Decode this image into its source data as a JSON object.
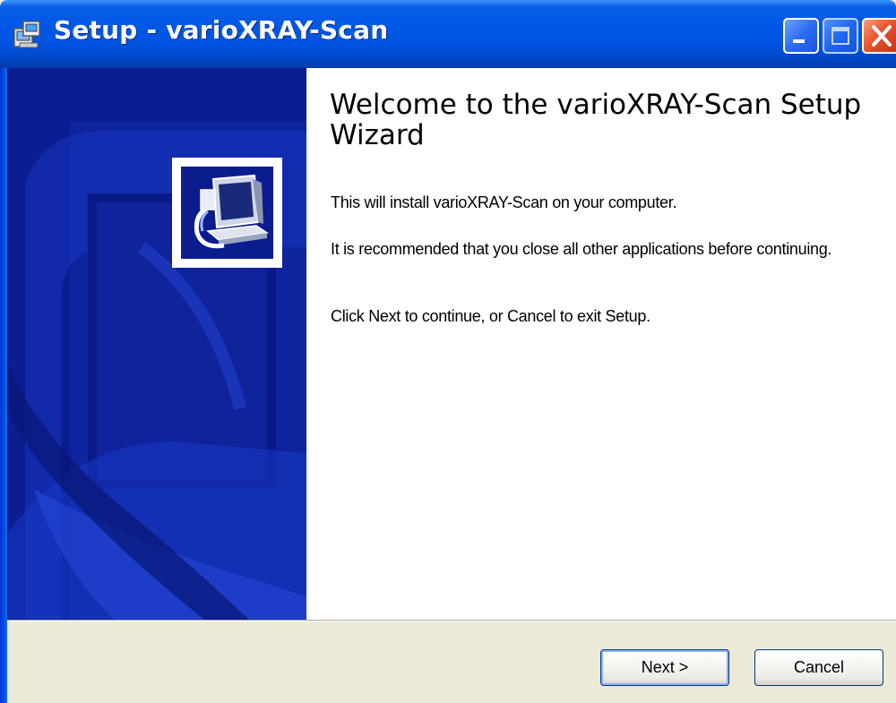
{
  "window": {
    "title": "Setup - varioXRAY-Scan"
  },
  "title_bar_buttons": {
    "minimize_icon": "minimize-icon",
    "maximize_icon": "maximize-icon",
    "close_icon": "close-icon"
  },
  "wizard": {
    "heading": "Welcome to the varioXRAY-Scan Setup Wizard",
    "paragraphs": [
      "This will install varioXRAY-Scan on your computer.",
      "It is recommended that you close all other applications before continuing.",
      "Click Next to continue, or Cancel to exit Setup."
    ]
  },
  "buttons": {
    "next_label": "Next >",
    "cancel_label": "Cancel"
  },
  "colors": {
    "title_bar": "#0054e3",
    "side_panel": "#0b1c8f",
    "dialog_face": "#ece9d8",
    "close_button": "#e5532e"
  }
}
